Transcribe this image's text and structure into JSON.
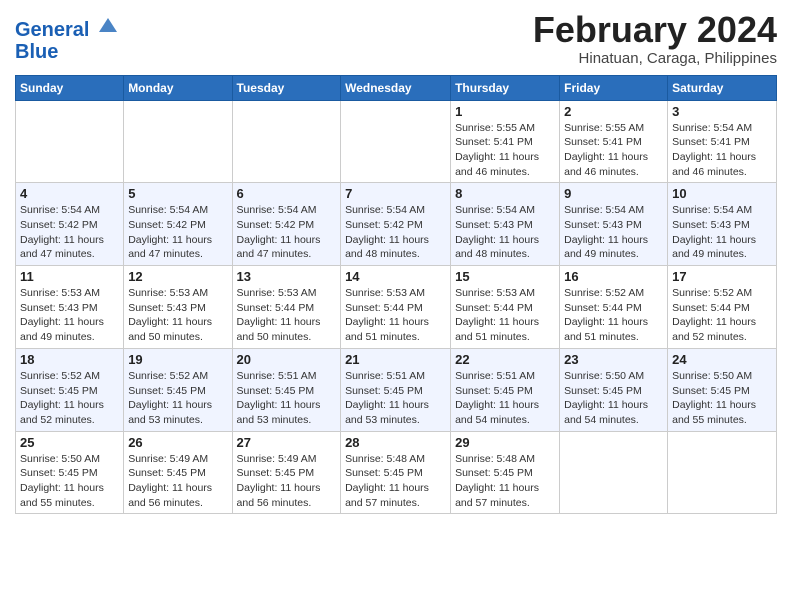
{
  "logo": {
    "line1": "General",
    "line2": "Blue"
  },
  "title": "February 2024",
  "subtitle": "Hinatuan, Caraga, Philippines",
  "weekdays": [
    "Sunday",
    "Monday",
    "Tuesday",
    "Wednesday",
    "Thursday",
    "Friday",
    "Saturday"
  ],
  "weeks": [
    [
      {
        "day": "",
        "info": ""
      },
      {
        "day": "",
        "info": ""
      },
      {
        "day": "",
        "info": ""
      },
      {
        "day": "",
        "info": ""
      },
      {
        "day": "1",
        "info": "Sunrise: 5:55 AM\nSunset: 5:41 PM\nDaylight: 11 hours\nand 46 minutes."
      },
      {
        "day": "2",
        "info": "Sunrise: 5:55 AM\nSunset: 5:41 PM\nDaylight: 11 hours\nand 46 minutes."
      },
      {
        "day": "3",
        "info": "Sunrise: 5:54 AM\nSunset: 5:41 PM\nDaylight: 11 hours\nand 46 minutes."
      }
    ],
    [
      {
        "day": "4",
        "info": "Sunrise: 5:54 AM\nSunset: 5:42 PM\nDaylight: 11 hours\nand 47 minutes."
      },
      {
        "day": "5",
        "info": "Sunrise: 5:54 AM\nSunset: 5:42 PM\nDaylight: 11 hours\nand 47 minutes."
      },
      {
        "day": "6",
        "info": "Sunrise: 5:54 AM\nSunset: 5:42 PM\nDaylight: 11 hours\nand 47 minutes."
      },
      {
        "day": "7",
        "info": "Sunrise: 5:54 AM\nSunset: 5:42 PM\nDaylight: 11 hours\nand 48 minutes."
      },
      {
        "day": "8",
        "info": "Sunrise: 5:54 AM\nSunset: 5:43 PM\nDaylight: 11 hours\nand 48 minutes."
      },
      {
        "day": "9",
        "info": "Sunrise: 5:54 AM\nSunset: 5:43 PM\nDaylight: 11 hours\nand 49 minutes."
      },
      {
        "day": "10",
        "info": "Sunrise: 5:54 AM\nSunset: 5:43 PM\nDaylight: 11 hours\nand 49 minutes."
      }
    ],
    [
      {
        "day": "11",
        "info": "Sunrise: 5:53 AM\nSunset: 5:43 PM\nDaylight: 11 hours\nand 49 minutes."
      },
      {
        "day": "12",
        "info": "Sunrise: 5:53 AM\nSunset: 5:43 PM\nDaylight: 11 hours\nand 50 minutes."
      },
      {
        "day": "13",
        "info": "Sunrise: 5:53 AM\nSunset: 5:44 PM\nDaylight: 11 hours\nand 50 minutes."
      },
      {
        "day": "14",
        "info": "Sunrise: 5:53 AM\nSunset: 5:44 PM\nDaylight: 11 hours\nand 51 minutes."
      },
      {
        "day": "15",
        "info": "Sunrise: 5:53 AM\nSunset: 5:44 PM\nDaylight: 11 hours\nand 51 minutes."
      },
      {
        "day": "16",
        "info": "Sunrise: 5:52 AM\nSunset: 5:44 PM\nDaylight: 11 hours\nand 51 minutes."
      },
      {
        "day": "17",
        "info": "Sunrise: 5:52 AM\nSunset: 5:44 PM\nDaylight: 11 hours\nand 52 minutes."
      }
    ],
    [
      {
        "day": "18",
        "info": "Sunrise: 5:52 AM\nSunset: 5:45 PM\nDaylight: 11 hours\nand 52 minutes."
      },
      {
        "day": "19",
        "info": "Sunrise: 5:52 AM\nSunset: 5:45 PM\nDaylight: 11 hours\nand 53 minutes."
      },
      {
        "day": "20",
        "info": "Sunrise: 5:51 AM\nSunset: 5:45 PM\nDaylight: 11 hours\nand 53 minutes."
      },
      {
        "day": "21",
        "info": "Sunrise: 5:51 AM\nSunset: 5:45 PM\nDaylight: 11 hours\nand 53 minutes."
      },
      {
        "day": "22",
        "info": "Sunrise: 5:51 AM\nSunset: 5:45 PM\nDaylight: 11 hours\nand 54 minutes."
      },
      {
        "day": "23",
        "info": "Sunrise: 5:50 AM\nSunset: 5:45 PM\nDaylight: 11 hours\nand 54 minutes."
      },
      {
        "day": "24",
        "info": "Sunrise: 5:50 AM\nSunset: 5:45 PM\nDaylight: 11 hours\nand 55 minutes."
      }
    ],
    [
      {
        "day": "25",
        "info": "Sunrise: 5:50 AM\nSunset: 5:45 PM\nDaylight: 11 hours\nand 55 minutes."
      },
      {
        "day": "26",
        "info": "Sunrise: 5:49 AM\nSunset: 5:45 PM\nDaylight: 11 hours\nand 56 minutes."
      },
      {
        "day": "27",
        "info": "Sunrise: 5:49 AM\nSunset: 5:45 PM\nDaylight: 11 hours\nand 56 minutes."
      },
      {
        "day": "28",
        "info": "Sunrise: 5:48 AM\nSunset: 5:45 PM\nDaylight: 11 hours\nand 57 minutes."
      },
      {
        "day": "29",
        "info": "Sunrise: 5:48 AM\nSunset: 5:45 PM\nDaylight: 11 hours\nand 57 minutes."
      },
      {
        "day": "",
        "info": ""
      },
      {
        "day": "",
        "info": ""
      }
    ]
  ]
}
